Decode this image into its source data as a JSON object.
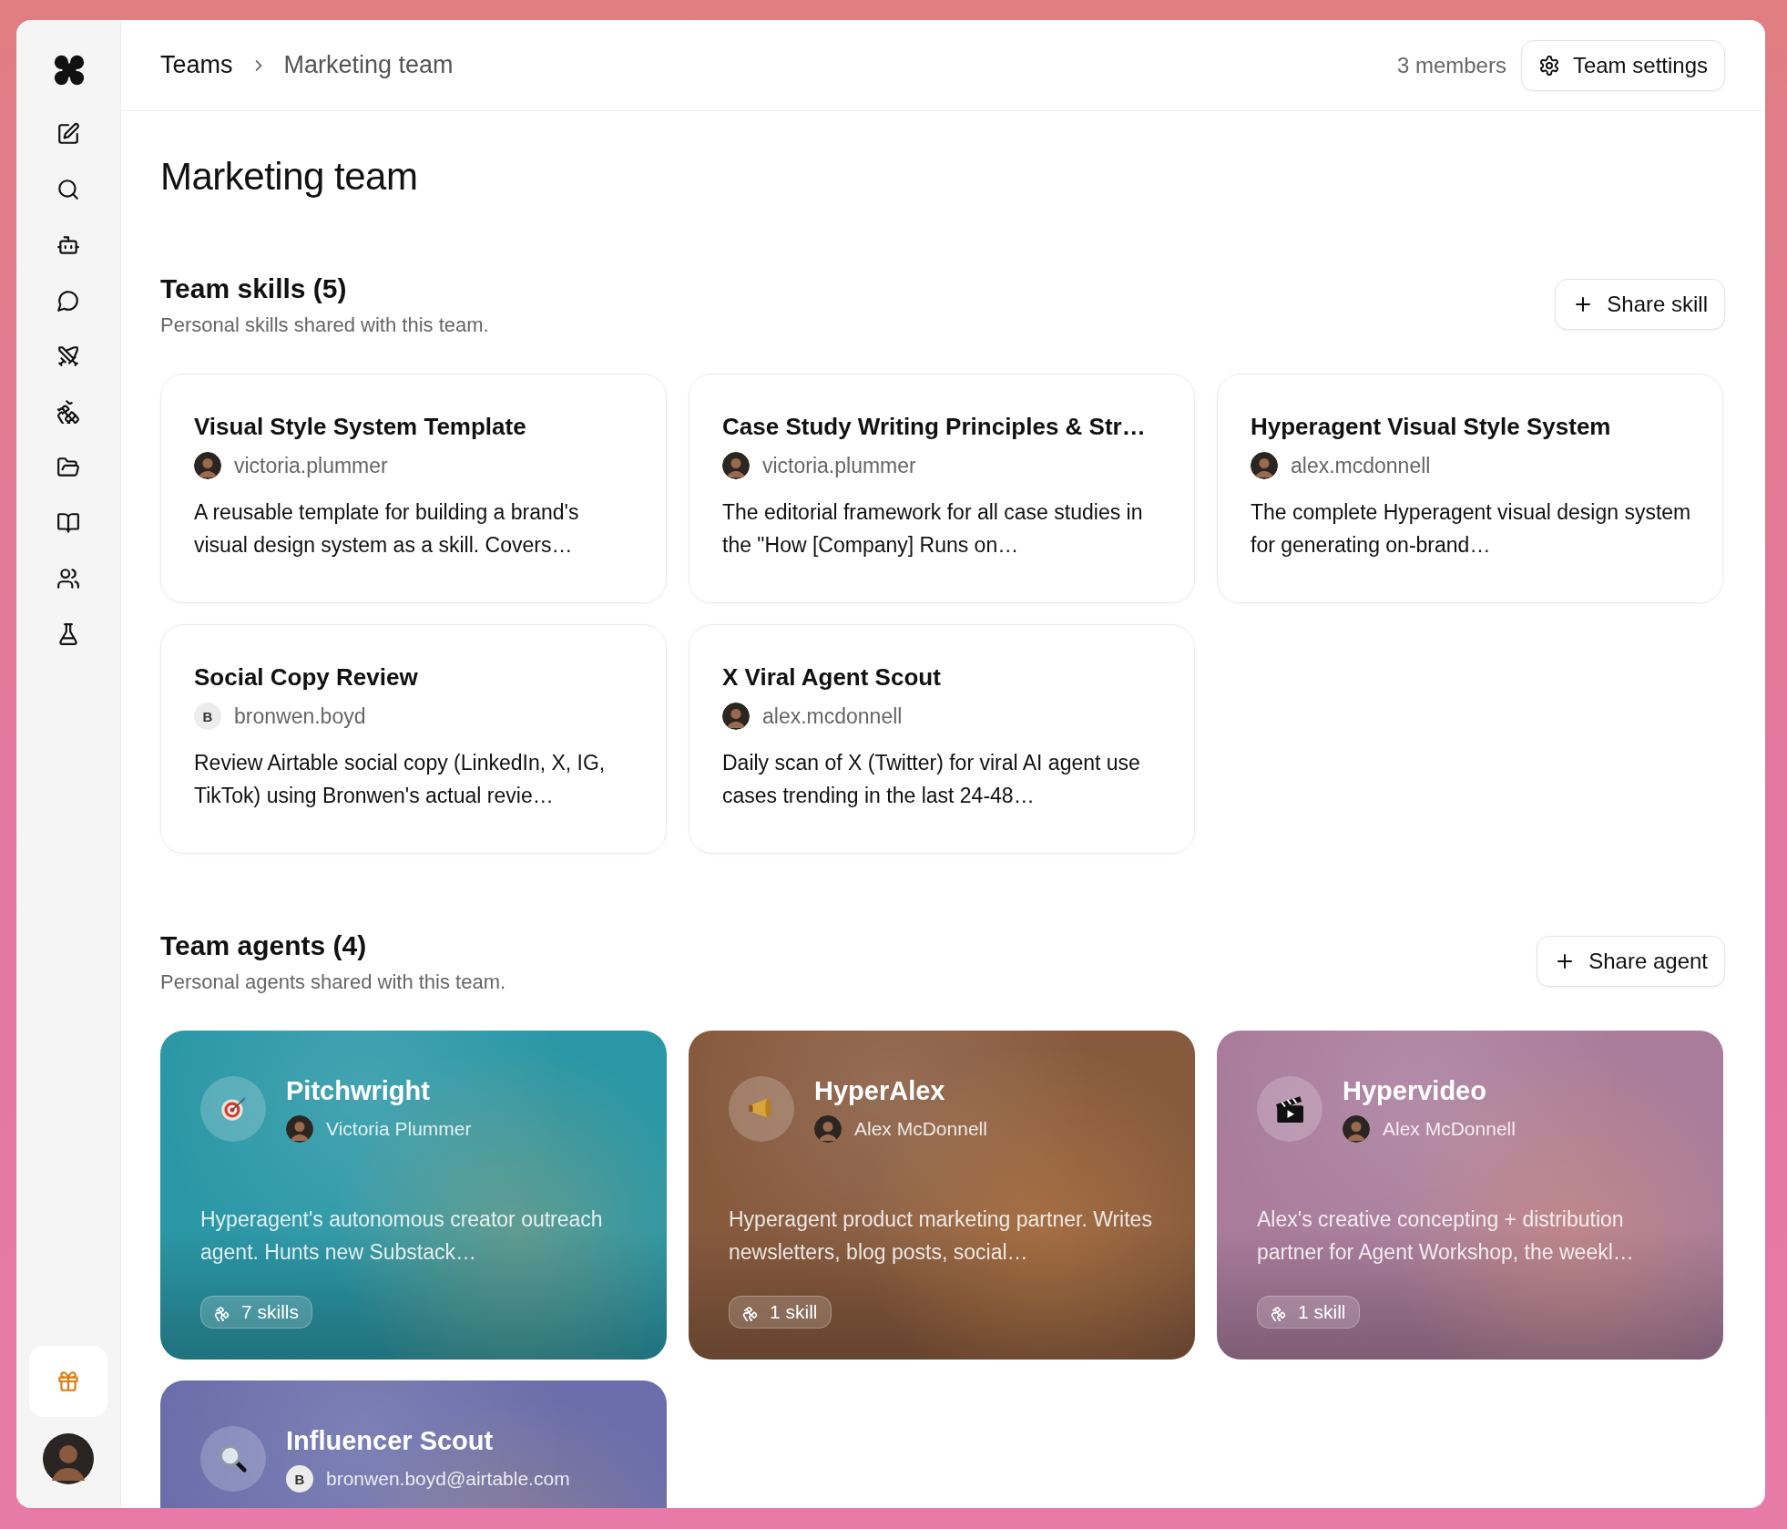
{
  "breadcrumb": [
    {
      "label": "Teams"
    },
    {
      "label": "Marketing team"
    }
  ],
  "header": {
    "members": "3 members",
    "settings_button": "Team settings"
  },
  "title": "Marketing team",
  "skills": {
    "heading": "Team skills (5)",
    "subtitle": "Personal skills shared with this team.",
    "share_button": "Share skill",
    "items": [
      {
        "title": "Visual Style System Template",
        "author": "victoria.plummer",
        "avatar": {
          "kind": "photo"
        },
        "description": "A reusable template for building a brand's visual design system as a skill. Covers…"
      },
      {
        "title": "Case Study Writing Principles & Str…",
        "author": "victoria.plummer",
        "avatar": {
          "kind": "photo"
        },
        "description": "The editorial framework for all case studies in the \"How [Company] Runs on…"
      },
      {
        "title": "Hyperagent Visual Style System",
        "author": "alex.mcdonnell",
        "avatar": {
          "kind": "photo"
        },
        "description": "The complete Hyperagent visual design system for generating on-brand…"
      },
      {
        "title": "Social Copy Review",
        "author": "bronwen.boyd",
        "avatar": {
          "kind": "initial",
          "letter": "B"
        },
        "description": "Review Airtable social copy (LinkedIn, X, IG, TikTok) using Bronwen's actual revie…"
      },
      {
        "title": "X Viral Agent Scout",
        "author": "alex.mcdonnell",
        "avatar": {
          "kind": "photo"
        },
        "description": "Daily scan of X (Twitter) for viral AI agent use cases trending in the last 24-48…"
      }
    ]
  },
  "agents": {
    "heading": "Team agents (4)",
    "subtitle": "Personal agents shared with this team.",
    "share_button": "Share agent",
    "items": [
      {
        "name": "Pitchwright",
        "author": "Victoria Plummer",
        "avatar": {
          "kind": "photo"
        },
        "kind": "target",
        "color": "#2b97a6",
        "description": "Hyperagent's autonomous creator outreach agent. Hunts new Substack…",
        "skills": "7 skills"
      },
      {
        "name": "HyperAlex",
        "author": "Alex McDonnell",
        "avatar": {
          "kind": "photo"
        },
        "kind": "megaphone",
        "color": "#875a3e",
        "description": "Hyperagent product marketing partner. Writes newsletters, blog posts, social…",
        "skills": "1 skill"
      },
      {
        "name": "Hypervideo",
        "author": "Alex McDonnell",
        "avatar": {
          "kind": "photo"
        },
        "kind": "clapper",
        "color": "#a97c9c",
        "description": "Alex's creative concepting + distribution partner for Agent Workshop, the weekl…",
        "skills": "1 skill"
      },
      {
        "name": "Influencer Scout",
        "author": "bronwen.boyd@airtable.com",
        "avatar": {
          "kind": "initial",
          "letter": "B"
        },
        "kind": "magnifier",
        "color": "#6a6fab"
      }
    ]
  }
}
